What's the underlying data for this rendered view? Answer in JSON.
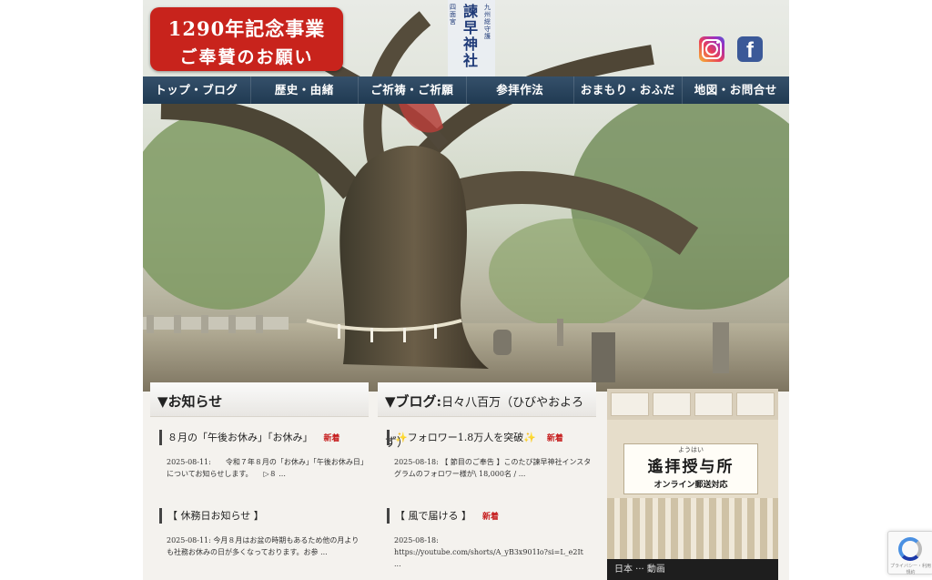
{
  "banner": {
    "line1": "1290年記念事業",
    "line2": "ご奉賛のお願い"
  },
  "logo": {
    "main": "諫早神社",
    "sub_right": "九州総守護",
    "sub_left": "四面宮",
    "sub_bottom": "神亀五年創建"
  },
  "social": {
    "instagram": "Instagram",
    "facebook": "f"
  },
  "nav": [
    {
      "label": "トップ・ブログ"
    },
    {
      "label": "歴史・由緒"
    },
    {
      "label": "ご祈祷・ご祈願"
    },
    {
      "label": "参拝作法"
    },
    {
      "label": "おまもり・おふだ"
    },
    {
      "label": "地図・お問合せ"
    }
  ],
  "news": {
    "heading": "▼お知らせ",
    "posts": [
      {
        "title": "８月の「午後お休み」「お休み」",
        "badge": "新着",
        "excerpt": "2025-08-11:　　令和７年８月の「お休み」「午後お休み日」についてお知らせします。　　▷８ ..."
      },
      {
        "title": "【 休務日お知らせ 】",
        "badge": "",
        "excerpt": "2025-08-11: 今月８月はお盆の時期もあるため他の月よりも社務お休みの日が多くなっております。お参 ..."
      }
    ]
  },
  "blog": {
    "heading": "▼ブログ:",
    "subheading": "日々八百万（ひびやおよろず）",
    "posts": [
      {
        "title": "✨フォロワー1.8万人を突破✨",
        "badge": "新着",
        "excerpt": "2025-08-18: 【 節目のご奉告 】このたび諫早神社インスタグラムのフォロワー様が\\ 18,000名 / ..."
      },
      {
        "title": "【 風で届ける 】",
        "badge": "新着",
        "excerpt": "2025-08-18: https://youtube.com/shorts/A_yB3x901Io?si=L_e2It ..."
      }
    ]
  },
  "side_banner": {
    "ruby": "ようはい",
    "title": "遙拝授与所",
    "subtitle": "オンライン郵送対応"
  },
  "video": {
    "label": "日本 ··· 動画"
  },
  "recaptcha": {
    "text": "プライバシー・利用規約"
  }
}
